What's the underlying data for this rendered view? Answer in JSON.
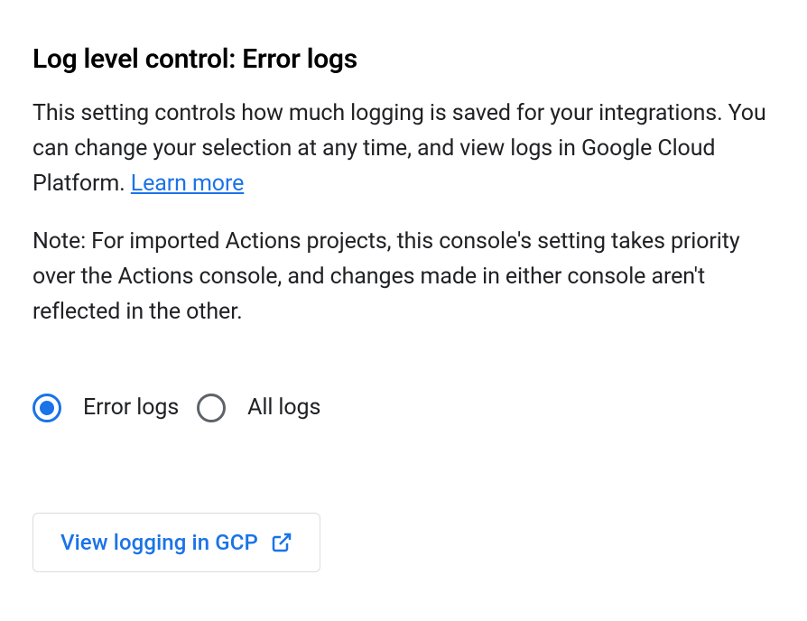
{
  "heading": "Log level control: Error logs",
  "description_part1": "This setting controls how much logging is saved for your integrations. You can change your selection at any time, and view logs in Google Cloud Platform. ",
  "learn_more_label": "Learn more",
  "note": "Note: For imported Actions projects, this console's setting takes priority over the Actions console, and changes made in either console aren't reflected in the other.",
  "radio_options": {
    "error_logs": "Error logs",
    "all_logs": "All logs"
  },
  "gcp_button_label": "View logging in GCP",
  "colors": {
    "link": "#1a73e8",
    "text": "#202124",
    "border": "#dadce0",
    "radio_unselected": "#5f6368"
  }
}
